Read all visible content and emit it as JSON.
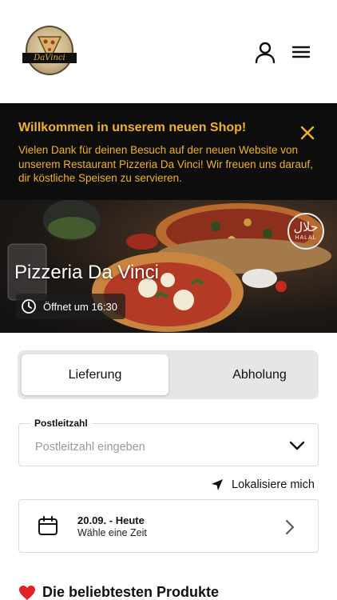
{
  "header": {
    "logo_text": "DaVinci",
    "icons": {
      "account": "user-icon",
      "menu": "hamburger-menu-icon"
    }
  },
  "announcement": {
    "title": "Willkommen in unserem neuen Shop!",
    "body": "Vielen Dank für deinen Besuch auf der neuen Website von unserem Restaurant Pizzeria Da Vinci! Wir freuen uns darauf, dir köstliche Speisen zu servieren.",
    "close_icon": "close-icon",
    "colors": {
      "background": "#0d0d0d",
      "accent": "#f0b12b"
    }
  },
  "hero": {
    "restaurant_name": "Pizzeria Da Vinci",
    "status": "Öffnet um 16:30",
    "badge": {
      "arabic": "حلال",
      "label": "HALAL"
    }
  },
  "order_type": {
    "options": [
      "Lieferung",
      "Abholung"
    ],
    "selected": "Lieferung"
  },
  "postal": {
    "label": "Postleitzahl",
    "placeholder": "Postleitzahl eingeben"
  },
  "locate": {
    "label": "Lokalisiere mich"
  },
  "time": {
    "date": "20.09. - Heute",
    "hint": "Wähle eine Zeit"
  },
  "popular": {
    "title": "Die beliebtesten Produkte",
    "icon": "heart-icon"
  }
}
